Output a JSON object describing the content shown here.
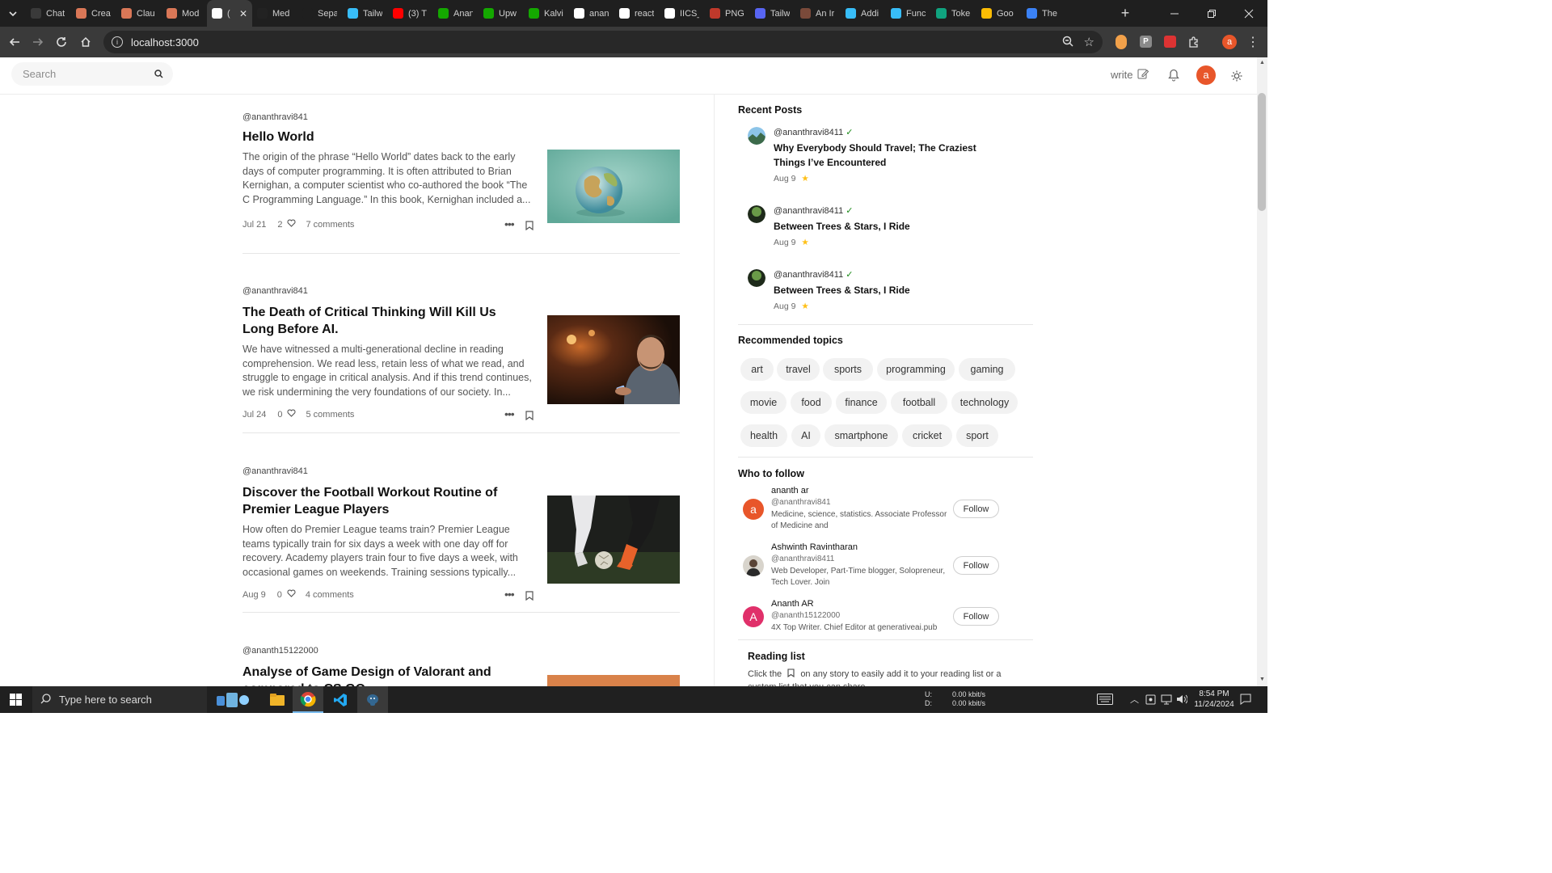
{
  "browser": {
    "tabs": [
      {
        "label": "Chat",
        "icon": "chatgpt-icon",
        "color": "#3a3a3a"
      },
      {
        "label": "Crea",
        "icon": "claude-icon",
        "color": "#d97757"
      },
      {
        "label": "Clau",
        "icon": "claude-icon",
        "color": "#d97757"
      },
      {
        "label": "Mod",
        "icon": "claude-icon",
        "color": "#d97757"
      },
      {
        "label": "(",
        "icon": "app-icon",
        "color": "#ffffff",
        "active": true
      },
      {
        "label": "Med",
        "icon": "medium-icon",
        "color": "#222222"
      },
      {
        "label": "Sepa",
        "icon": "page-icon",
        "color": "#1f1f1f"
      },
      {
        "label": "Tailw",
        "icon": "map-pin-icon",
        "color": "#38bdf8"
      },
      {
        "label": "(3) T",
        "icon": "youtube-icon",
        "color": "#ff0000"
      },
      {
        "label": "Anan",
        "icon": "upwork-icon",
        "color": "#14a800"
      },
      {
        "label": "Upw",
        "icon": "upwork-icon",
        "color": "#14a800"
      },
      {
        "label": "Kalvi",
        "icon": "upwork-icon",
        "color": "#14a800"
      },
      {
        "label": "anan",
        "icon": "github-icon",
        "color": "#ffffff"
      },
      {
        "label": "react",
        "icon": "google-icon",
        "color": "#ffffff"
      },
      {
        "label": "IICS_",
        "icon": "github-icon",
        "color": "#ffffff"
      },
      {
        "label": "PNG",
        "icon": "png-icon",
        "color": "#c0392b"
      },
      {
        "label": "Tailw",
        "icon": "discord-icon",
        "color": "#5865f2"
      },
      {
        "label": "An Ir",
        "icon": "page-icon",
        "color": "#7a4a3a"
      },
      {
        "label": "Addi",
        "icon": "tailwind-icon",
        "color": "#38bdf8"
      },
      {
        "label": "Func",
        "icon": "tailwind-icon",
        "color": "#38bdf8"
      },
      {
        "label": "Toke",
        "icon": "openai-icon",
        "color": "#10a37f"
      },
      {
        "label": "Goo",
        "icon": "keep-icon",
        "color": "#fbbc04"
      },
      {
        "label": "The",
        "icon": "page-icon",
        "color": "#3b82f6"
      }
    ],
    "new_tab_label": "+",
    "url": "localhost:3000",
    "profile_letter": "a",
    "accent": "#e8562a"
  },
  "app": {
    "search_placeholder": "Search",
    "write_label": "write",
    "avatar_letter": "a",
    "avatar_color": "#e8562a"
  },
  "feed": [
    {
      "author": "@ananthravi841",
      "title": "Hello World",
      "excerpt": "The origin of the phrase “Hello World” dates back to the early days of computer programming. It is often attributed to Brian Kernighan, a computer scientist who co-authored the book “The C Programming Language.” In this book, Kernighan included a...",
      "date": "Jul 21",
      "likes": "2",
      "comments": "7 comments",
      "image": "globe-image"
    },
    {
      "author": "@ananthravi841",
      "title": "The Death of Critical Thinking Will Kill Us Long Before AI.",
      "excerpt": "We have witnessed a multi-generational decline in reading comprehension. We read less, retain less of what we read, and struggle to engage in critical analysis. And if this trend continues, we risk undermining the very foundations of our society. In...",
      "date": "Jul 24",
      "likes": "0",
      "comments": "5 comments",
      "image": "man-phone-image"
    },
    {
      "author": "@ananthravi841",
      "title": "Discover the Football Workout Routine of Premier League Players",
      "excerpt": "How often do Premier League teams train? Premier League teams typically train for six days a week with one day off for recovery. Academy players train four to five days a week, with occasional games on weekends. Training sessions typically...",
      "date": "Aug 9",
      "likes": "0",
      "comments": "4 comments",
      "image": "football-image"
    },
    {
      "author": "@ananth15122000",
      "title": "Analyse of Game Design of Valorant and compared to CS GO",
      "excerpt": "",
      "date": "",
      "likes": "",
      "comments": "",
      "image": "valorant-image"
    }
  ],
  "sidebar": {
    "recent_title": "Recent Posts",
    "recent": [
      {
        "user": "@ananthravi8411",
        "verified": "✓",
        "title": "Why Everybody Should Travel; The Craziest Things I’ve Encountered",
        "date": "Aug 9"
      },
      {
        "user": "@ananthravi8411",
        "verified": "✓",
        "title": "Between Trees & Stars, I Ride",
        "date": "Aug 9"
      },
      {
        "user": "@ananthravi8411",
        "verified": "✓",
        "title": "Between Trees & Stars, I Ride",
        "date": "Aug 9"
      }
    ],
    "topics_title": "Recommended topics",
    "topics": [
      [
        "art",
        "travel",
        "sports",
        "programming",
        "gaming"
      ],
      [
        "movie",
        "food",
        "finance",
        "football",
        "technology"
      ],
      [
        "health",
        "AI",
        "smartphone",
        "cricket",
        "sport"
      ]
    ],
    "follow_title": "Who to follow",
    "follow": [
      {
        "name": "ananth ar",
        "handle": "@ananthravi841",
        "bio": "Medicine, science, statistics. Associate Professor of Medicine and",
        "avatar_letter": "a",
        "avatar_color": "#e8562a",
        "button": "Follow"
      },
      {
        "name": "Ashwinth Ravintharan",
        "handle": "@ananthravi8411",
        "bio": "Web Developer, Part-Time blogger, Solopreneur, Tech Lover. Join",
        "avatar_letter": "",
        "avatar_color": "#555555",
        "button": "Follow"
      },
      {
        "name": "Ananth AR",
        "handle": "@ananth15122000",
        "bio": "4X Top Writer. Chief Editor at generativeai.pub",
        "avatar_letter": "A",
        "avatar_color": "#e0306a",
        "button": "Follow"
      }
    ],
    "reading_title": "Reading list",
    "reading_text_before": "Click the",
    "reading_text_after": "on any story to easily add it to your reading list or a custom list that you can share."
  },
  "taskbar": {
    "search_placeholder": "Type here to search",
    "net_up_label": "U:",
    "net_down_label": "D:",
    "net_up": "0.00 kbit/s",
    "net_down": "0.00 kbit/s",
    "time": "8:54 PM",
    "date": "11/24/2024"
  }
}
